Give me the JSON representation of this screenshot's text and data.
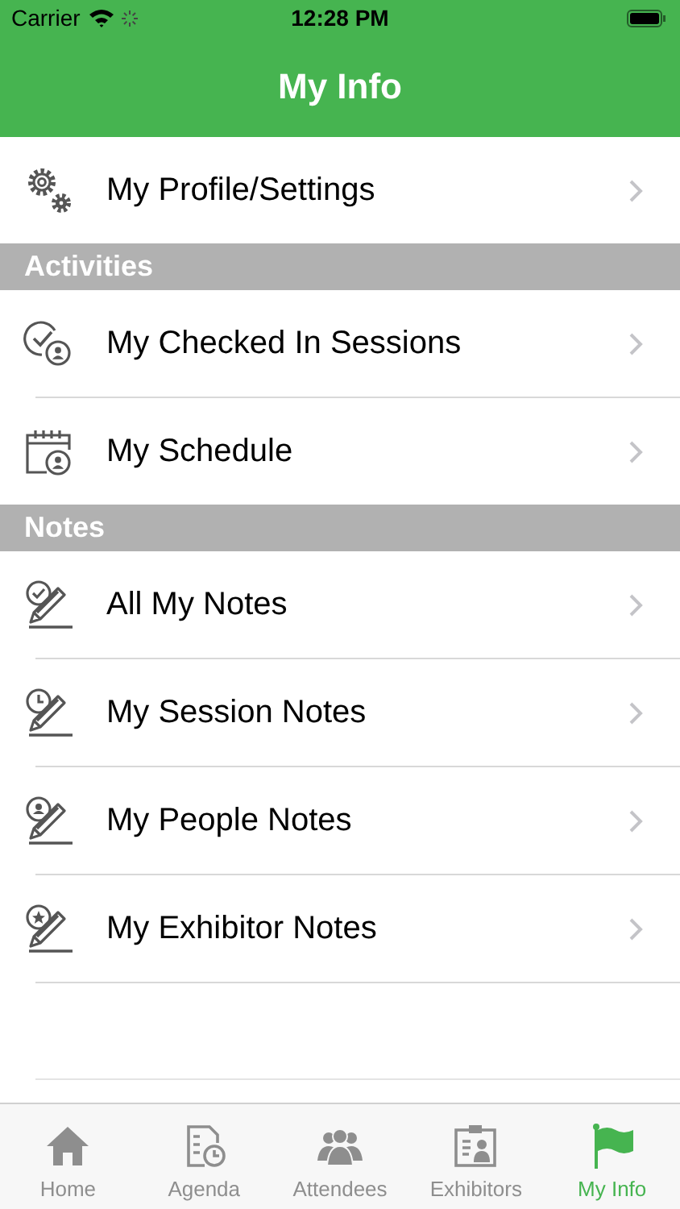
{
  "status_bar": {
    "carrier": "Carrier",
    "time": "12:28 PM"
  },
  "nav": {
    "title": "My Info"
  },
  "sections": [
    {
      "rows": [
        {
          "label": "My Profile/Settings"
        }
      ]
    },
    {
      "header": "Activities",
      "rows": [
        {
          "label": "My Checked In Sessions"
        },
        {
          "label": "My Schedule"
        }
      ]
    },
    {
      "header": "Notes",
      "rows": [
        {
          "label": "All My Notes"
        },
        {
          "label": "My Session Notes"
        },
        {
          "label": "My People Notes"
        },
        {
          "label": "My Exhibitor Notes"
        }
      ]
    }
  ],
  "tabs": [
    {
      "label": "Home",
      "selected": false
    },
    {
      "label": "Agenda",
      "selected": false
    },
    {
      "label": "Attendees",
      "selected": false
    },
    {
      "label": "Exhibitors",
      "selected": false
    },
    {
      "label": "My Info",
      "selected": true
    }
  ]
}
